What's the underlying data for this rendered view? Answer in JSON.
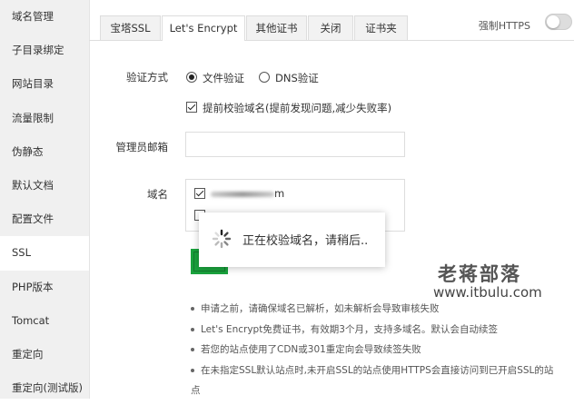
{
  "sidebar": {
    "items": [
      {
        "label": "域名管理"
      },
      {
        "label": "子目录绑定"
      },
      {
        "label": "网站目录"
      },
      {
        "label": "流量限制"
      },
      {
        "label": "伪静态"
      },
      {
        "label": "默认文档"
      },
      {
        "label": "配置文件"
      },
      {
        "label": "SSL"
      },
      {
        "label": "PHP版本"
      },
      {
        "label": "Tomcat"
      },
      {
        "label": "重定向"
      },
      {
        "label": "重定向(测试版)"
      }
    ],
    "active": "SSL"
  },
  "tabs": [
    {
      "label": "宝塔SSL"
    },
    {
      "label": "Let's Encrypt"
    },
    {
      "label": "其他证书"
    },
    {
      "label": "关闭"
    },
    {
      "label": "证书夹"
    }
  ],
  "active_tab": "Let's Encrypt",
  "force_https": {
    "label": "强制HTTPS",
    "enabled": false
  },
  "form": {
    "verify_method_label": "验证方式",
    "options": [
      {
        "label": "文件验证",
        "checked": true
      },
      {
        "label": "DNS验证",
        "checked": false
      }
    ],
    "precheck_label": "提前校验域名(提前发现问题,减少失败率)",
    "precheck_checked": true,
    "email_label": "管理员邮箱",
    "email_value": "",
    "domain_label": "域名",
    "domains": [
      {
        "suffix": "m",
        "checked": true
      },
      {
        "suffix": "",
        "checked": false
      }
    ]
  },
  "toast": {
    "text": "正在校验域名，请稍后.."
  },
  "watermark": {
    "name": "老蒋部落",
    "url": "www.itbulu.com"
  },
  "notes": [
    "申请之前，请确保域名已解析，如未解析会导致审核失败",
    "Let's Encrypt免费证书，有效期3个月，支持多域名。默认会自动续签",
    "若您的站点使用了CDN或301重定向会导致续签失败",
    "在未指定SSL默认站点时,未开启SSL的站点使用HTTPS会直接访问到已开启SSL的站",
    "点"
  ]
}
